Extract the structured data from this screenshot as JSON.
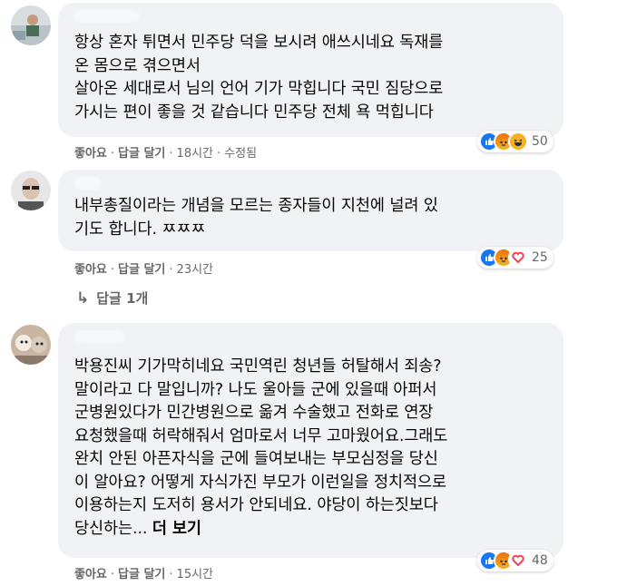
{
  "comments": [
    {
      "text": "항상 혼자 튀면서 민주당 덕을 보시려 애쓰시네요 독재를\n온 몸으로 겪으면서\n살아온 세대로서 님의 언어 기가 막힙니다 국민 짐당으로\n가시는 편이 좋을 것 같습니다 민주당 전체 욕 먹힙니다",
      "like": "좋아요",
      "reply": "답글 달기",
      "time": "18시간",
      "edited": "수정됨",
      "reaction_count": "50",
      "reactions": [
        "like-icon",
        "angry-icon",
        "haha-icon"
      ]
    },
    {
      "text": "내부총질이라는 개념을 모르는 종자들이 지천에 널려 있\n기도 합니다. ㅉㅉㅉ",
      "like": "좋아요",
      "reply": "답글 달기",
      "time": "23시간",
      "reaction_count": "25",
      "reactions": [
        "like-icon",
        "angry-icon",
        "love-icon"
      ]
    },
    {
      "text": "박용진씨 기가막히네요 국민역린 청년들 허탈해서 죄송?\n말이라고 다 말입니까? 나도 울아들 군에 있을때 아퍼서\n군병원있다가 민간병원으로 옮겨 수술했고 전화로 연장\n요청했을때 허락해줘서 엄마로서 너무 고마웠어요.그래도\n완치 안된 아픈자식을 군에 들여보내는 부모심정을 당신\n이 알아요? 어떻게 자식가진 부모가 이런일을 정치적으로\n이용하는지 도저히 용서가 안되네요. 야당이 하는짓보다\n당신하는... ",
      "more": "더 보기",
      "like": "좋아요",
      "reply": "답글 달기",
      "time": "15시간",
      "reaction_count": "48",
      "reactions": [
        "like-icon",
        "angry-icon",
        "love-icon"
      ]
    }
  ],
  "replies_link": "답글 1개",
  "colors": {
    "bubble": "#f0f2f5",
    "meta_text": "#65676b",
    "like_blue": "#1877f2",
    "love_red": "#f33e58"
  }
}
